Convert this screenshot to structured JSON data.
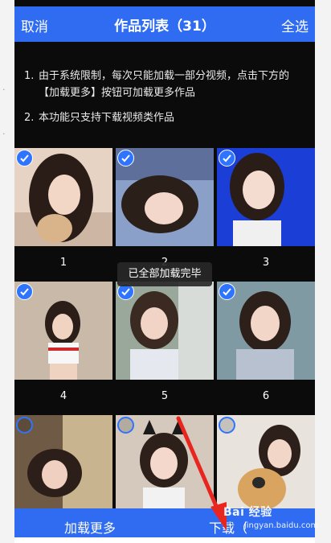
{
  "header": {
    "cancel_label": "取消",
    "title": "作品列表（31）",
    "select_all_label": "全选"
  },
  "notes": [
    {
      "num": "1.",
      "text": "由于系统限制，每次只能加载一部分视频，点击下方的【加载更多】按钮可加载更多作品"
    },
    {
      "num": "2.",
      "text": "本功能只支持下载视频类作品"
    }
  ],
  "grid": {
    "items": [
      {
        "index": "1",
        "checked": true
      },
      {
        "index": "2",
        "checked": true
      },
      {
        "index": "3",
        "checked": true
      },
      {
        "index": "4",
        "checked": true
      },
      {
        "index": "5",
        "checked": true
      },
      {
        "index": "6",
        "checked": true
      },
      {
        "index": "",
        "checked": false
      },
      {
        "index": "",
        "checked": false
      },
      {
        "index": "",
        "checked": false
      }
    ]
  },
  "toast": {
    "text": "已全部加载完毕"
  },
  "bottom_bar": {
    "load_more_label": "加载更多",
    "download_label": "下载（"
  },
  "watermark": {
    "logo": "Bai 经验",
    "url": "jingyan.baidu.com"
  },
  "colors": {
    "accent": "#2f6cf2",
    "check": "#2f74ff",
    "modal_bg": "#0b0b0b",
    "arrow": "#e8261f"
  }
}
